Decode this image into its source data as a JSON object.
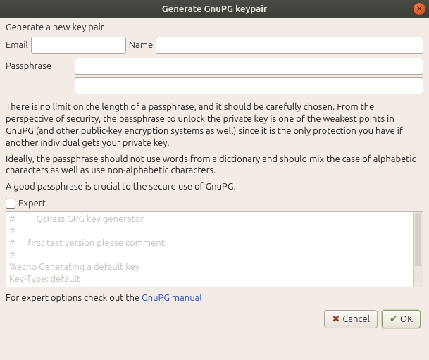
{
  "window": {
    "title": "Generate GnuPG keypair"
  },
  "heading": "Generate a new key pair",
  "fields": {
    "email_label": "Email",
    "email_value": "",
    "name_label": "Name",
    "name_value": "",
    "passphrase_label": "Passphrase",
    "passphrase_value": "",
    "confirm_value": ""
  },
  "info": {
    "p1": "There is no limit on the length of a passphrase, and it should be carefully chosen. From the perspective of security, the passphrase to unlock the private key is one of the weakest points in GnuPG (and other public-key encryption systems as well) since it is the only protection you have if another individual gets your private key.",
    "p2": "Ideally, the passphrase should not use words from a dictionary and should mix the case of alphabetic characters as well as use non-alphabetic characters.",
    "p3": "A good passphrase is crucial to the secure use of GnuPG."
  },
  "expert": {
    "label": "Expert",
    "checked": false,
    "textarea": "#          QtPass GPG key generator\n#\n#      first test version please comment\n#\n%echo Generating a default key\nKey-Type: default\nSubkey-Type: default\nName-Real:"
  },
  "footer": {
    "text_prefix": "For expert options check out the ",
    "link_text": "GnuPG manual"
  },
  "buttons": {
    "cancel": "Cancel",
    "ok": "OK"
  }
}
